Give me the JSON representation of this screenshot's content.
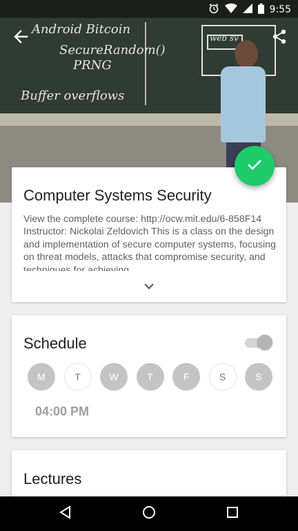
{
  "status_bar": {
    "time": "9:55",
    "icons": [
      "alarm-icon",
      "wifi-icon",
      "signal-icon",
      "battery-icon"
    ]
  },
  "hero": {
    "chalk_lines": [
      "Android Bitcoin",
      "SecureRandom()",
      "PRNG",
      "Buffer overflows"
    ],
    "chalk_right": "web sv"
  },
  "toolbar": {
    "back_icon": "arrow-left-icon",
    "share_icon": "share-icon"
  },
  "fab": {
    "icon": "check-icon",
    "color": "#1fcb6b"
  },
  "course": {
    "title": "Computer Systems Security",
    "description": "View the complete course: http://ocw.mit.edu/6-858F14 Instructor: Nickolai Zeldovich This is a class on the design and implementation of secure computer systems, focusing on threat models, attacks that compromise security, and techniques for achieving",
    "expand_icon": "chevron-down-icon"
  },
  "schedule": {
    "title": "Schedule",
    "enabled": true,
    "days": [
      {
        "label": "M",
        "selected": true
      },
      {
        "label": "T",
        "selected": false
      },
      {
        "label": "W",
        "selected": true
      },
      {
        "label": "T",
        "selected": true
      },
      {
        "label": "F",
        "selected": true
      },
      {
        "label": "S",
        "selected": false
      },
      {
        "label": "S",
        "selected": true
      }
    ],
    "time": "04:00 PM"
  },
  "lectures": {
    "title": "Lectures"
  },
  "navbar": {
    "icons": [
      "back-triangle-icon",
      "home-circle-icon",
      "recents-square-icon"
    ]
  }
}
